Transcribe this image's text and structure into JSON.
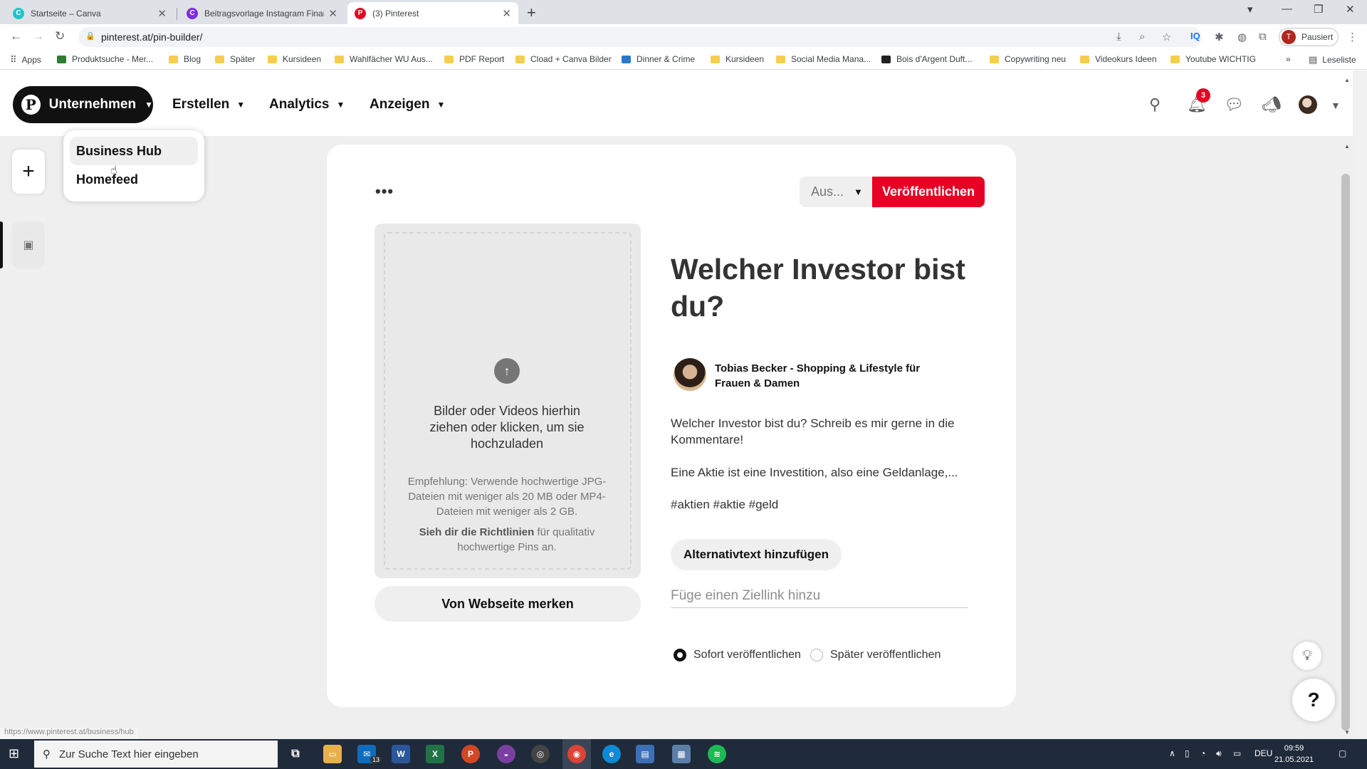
{
  "browser": {
    "tabs": [
      {
        "label": "Startseite – Canva",
        "favicon": "canva-icon",
        "active": false
      },
      {
        "label": "Beitragsvorlage Instagram Finanz",
        "favicon": "canva-icon",
        "active": false
      },
      {
        "label": "(3) Pinterest",
        "favicon": "pinterest-icon",
        "active": true
      }
    ],
    "url": "pinterest.at/pin-builder/",
    "profile_label": "Pausiert",
    "profile_initial": "T",
    "bookmarks": [
      "Apps",
      "Produktsuche - Mer...",
      "Blog",
      "Später",
      "Kursideen",
      "Wahlfächer WU Aus...",
      "PDF Report",
      "Cload + Canva Bilder",
      "Dinner & Crime",
      "Kursideen",
      "Social Media Mana...",
      "Bois d'Argent Duft...",
      "Copywriting neu",
      "Videokurs Ideen",
      "Youtube WICHTIG"
    ],
    "bookmarks_more": "»",
    "reading_list": "Leseliste",
    "status_url": "https://www.pinterest.at/business/hub"
  },
  "header": {
    "business_button": "Unternehmen",
    "nav": [
      "Erstellen",
      "Analytics",
      "Anzeigen"
    ],
    "notification_count": "3"
  },
  "dropdown": {
    "items": [
      "Business Hub",
      "Homefeed"
    ]
  },
  "pin_builder": {
    "board_select": "Aus...",
    "publish_button": "Veröffentlichen",
    "upload_main": "Bilder oder Videos hierhin ziehen oder klicken, um sie hochzuladen",
    "upload_hint": "Empfehlung: Verwende hochwertige JPG-Dateien mit weniger als 20 MB oder MP4-Dateien mit weniger als 2 GB.",
    "guidelines_link": "Sieh dir die Richtlinien",
    "guidelines_rest": " für qualitativ hochwertige Pins an.",
    "website_button": "Von Webseite merken",
    "title": "Welcher Investor bist du?",
    "creator_name": "Tobias Becker - Shopping & Lifestyle für Frauen & Damen",
    "description": [
      "Welcher Investor bist du? Schreib es mir gerne in die Kommentare!",
      "Eine Aktie ist eine Investition, also eine Geldanlage,...",
      "#aktien #aktie #geld"
    ],
    "alt_text_button": "Alternativtext hinzufügen",
    "link_placeholder": "Füge einen Ziellink hinzu",
    "publish_options": [
      "Sofort veröffentlichen",
      "Später veröffentlichen"
    ],
    "selected_publish_option": "Sofort veröffentlichen"
  },
  "taskbar": {
    "search_placeholder": "Zur Suche Text hier eingeben",
    "mail_count": "13",
    "language": "DEU",
    "time": "09:59",
    "date": "21.05.2021"
  },
  "colors": {
    "pinterest_red": "#e60023",
    "dark": "#111111",
    "canvas_bg": "#efefef"
  }
}
